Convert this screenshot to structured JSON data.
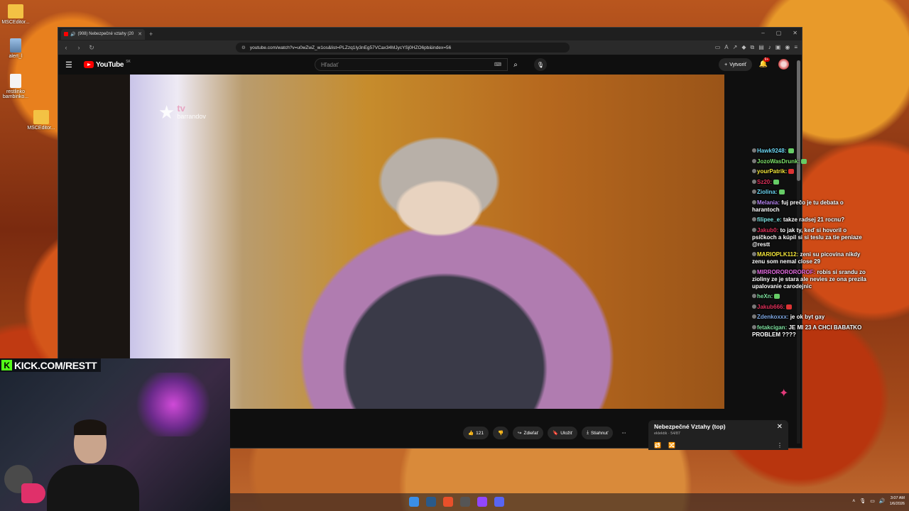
{
  "desktop": {
    "icons": [
      {
        "label": "MSCEditor...",
        "kind": "folder"
      },
      {
        "label": "alert_l",
        "kind": "app"
      },
      {
        "label": "restlinko bambinko...",
        "kind": "file"
      },
      {
        "label": "MSCEditor...",
        "kind": "folder"
      }
    ]
  },
  "browser": {
    "tab_title": "(908) Nebezpečné vztahy (20",
    "url": "youtube.com/watch?v=u0wZwZ_w1os&list=PLZzq1Iy3nEg57VCax34MJycYSj0HZO6pb&index=56"
  },
  "youtube": {
    "logo_text": "YouTube",
    "region": "SK",
    "search_placeholder": "Hľadať",
    "create_label": "Vytvoriť",
    "notif_count": "9+",
    "video_logo_tv": "tv",
    "video_logo_brand": "barrandov",
    "actions": {
      "likes": "121",
      "share": "Zdieľať",
      "save": "Uložiť",
      "download": "Stiahnuť"
    },
    "playlist": {
      "title": "Nebezpečné Vztahy (top)",
      "subtitle": "eklektik · 54/87"
    }
  },
  "chat": [
    {
      "user": "Hawk9248:",
      "color": "#6bd5f2",
      "text": ""
    },
    {
      "user": "JozoWasDrunk:",
      "color": "#7ee36a",
      "text": ""
    },
    {
      "user": "yourPatrik:",
      "color": "#f5e83a",
      "text": ""
    },
    {
      "user": "Sz20:",
      "color": "#e0305a",
      "text": ""
    },
    {
      "user": "Ziolina:",
      "color": "#6bd5f2",
      "text": ""
    },
    {
      "user": "Melania:",
      "color": "#b583f0",
      "text": "fuj prečo je tu debata o harantoch"
    },
    {
      "user": "filipee_e:",
      "color": "#7ee3e3",
      "text": "takze radsej 21 rocnu?"
    },
    {
      "user": "Jakub0:",
      "color": "#e0305a",
      "text": "to jak ty, keď si hovoril o psíčkoch a kúpil si si teslu za tie peniaze @restt"
    },
    {
      "user": "MARIOPLK112:",
      "color": "#f5e83a",
      "text": "zeni su picovina nikdy zenu som nemal close 29"
    },
    {
      "user": "MIRROROROROROF:",
      "color": "#e36ae0",
      "text": "robis si srandu zo zioliny ze je stara ale nevies ze ona prezila upalovanie carodejnic"
    },
    {
      "user": "heXn:",
      "color": "#7ee3a0",
      "text": ""
    },
    {
      "user": "Jakub666:",
      "color": "#e0305a",
      "text": ""
    },
    {
      "user": "Zdenkoxxx:",
      "color": "#7ea8e3",
      "text": "je ok byt gay"
    },
    {
      "user": "fetakcigan:",
      "color": "#7ee3a0",
      "text": "JE MI 23 A CHCI BABATKO PROBLEM ????"
    }
  ],
  "stream": {
    "kick_label": "KICK.COM/RESTT"
  },
  "taskbar": {
    "time": "3:07 AM",
    "date": "1/6/2026"
  },
  "colors": {
    "kick_green": "#53fc18",
    "yt_red": "#ff0000"
  }
}
